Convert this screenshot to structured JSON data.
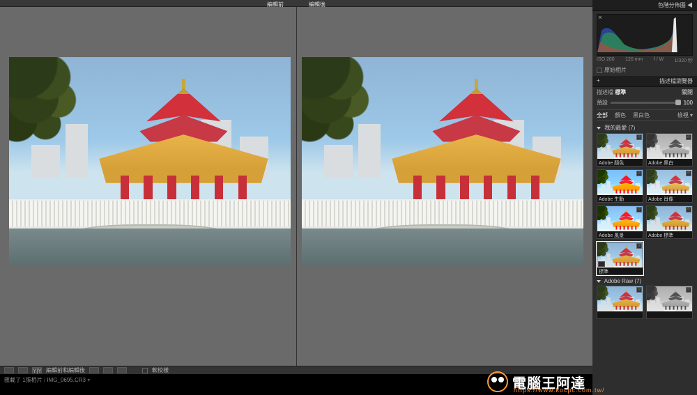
{
  "top": {
    "before": "編輯前",
    "after": "編輯後"
  },
  "exif": {
    "iso_label": "ISO 200",
    "focal": "120 mm",
    "aperture": "f / W",
    "shutter": "1/320 秒"
  },
  "original_check_label": "原始相片",
  "right": {
    "histogram_title": "色階分佈圖 ◀",
    "browser_title": "描述檔瀏覽器",
    "plus": "+",
    "profile_label": "描述檔",
    "profile_value": "標準",
    "reset": "關閉",
    "tint_label": "預設",
    "tint_value": "100",
    "filters": {
      "all": "全部",
      "color": "顏色",
      "bw": "黑白色",
      "fav": "檢視 ▾"
    }
  },
  "presets": {
    "mine_header": "我的最愛 (7)",
    "items": [
      {
        "label": "Adobe 顏色",
        "cls": ""
      },
      {
        "label": "Adobe 黑白",
        "cls": "bw"
      },
      {
        "label": "Adobe 生動",
        "cls": "vivid"
      },
      {
        "label": "Adobe 肖像",
        "cls": "portrait"
      },
      {
        "label": "Adobe 風景",
        "cls": "landscape"
      },
      {
        "label": "Adobe 標準",
        "cls": ""
      },
      {
        "label": "標準",
        "cls": "",
        "selected": true,
        "badge": true
      }
    ],
    "raw_header": "Adobe Raw (7)",
    "raw_items": [
      {
        "label": "",
        "cls": ""
      },
      {
        "label": "",
        "cls": "bw"
      }
    ]
  },
  "bottom": {
    "view_label": "編輯前和編輯後",
    "soft_proof": "軟校樣",
    "status_prefix": "匯載了",
    "status_count": "1張相片",
    "filename": "IMG_0695.CR3"
  },
  "watermark": {
    "text": "電腦王阿達",
    "url": "https://www.kocpc.com.tw/"
  }
}
